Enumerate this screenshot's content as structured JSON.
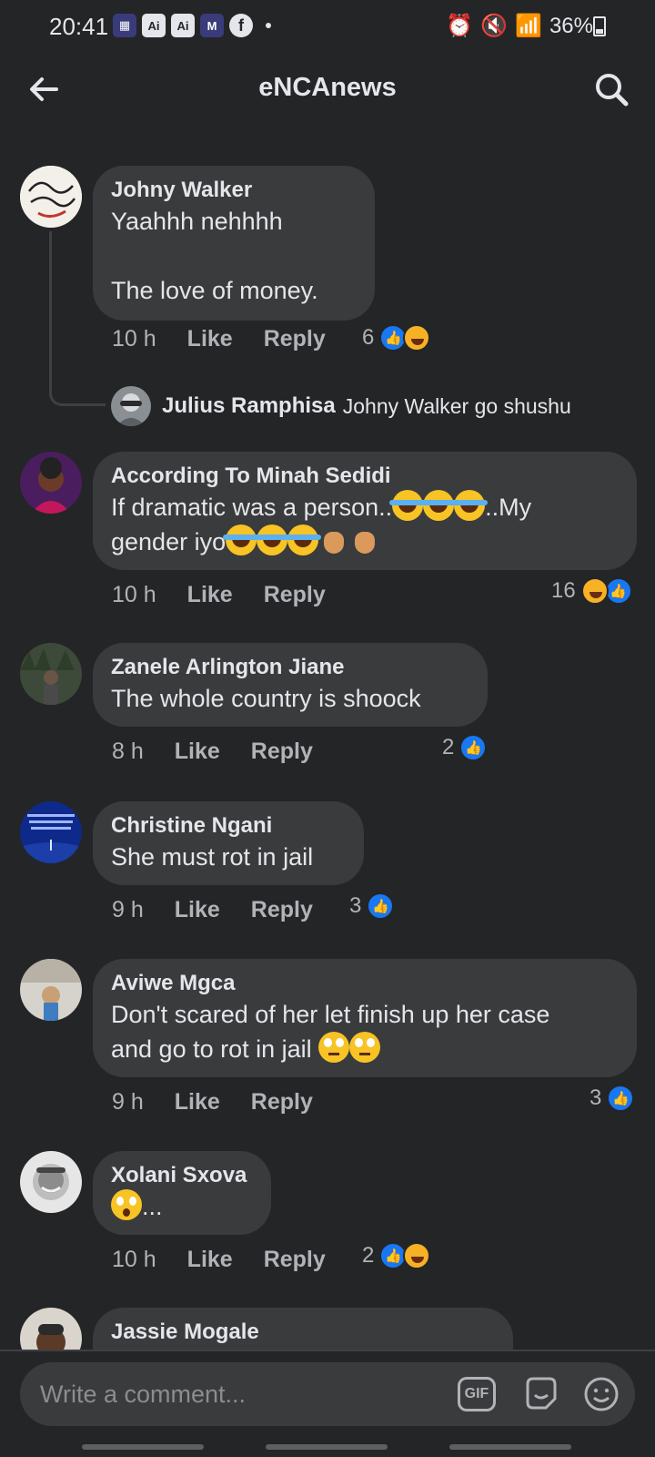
{
  "status": {
    "time": "20:41",
    "apps": [
      "Ai",
      "Ai",
      "M"
    ],
    "battery": "36%"
  },
  "header": {
    "title": "eNCAnews"
  },
  "comments": [
    {
      "name": "Johny Walker",
      "text": "Yaahhh nehhhh\n\nThe love of money.",
      "time": "10 h",
      "like": "Like",
      "reply": "Reply",
      "reactions": "6",
      "reply_preview": {
        "name": "Julius Ramphisa",
        "text": "Johny Walker go shushu"
      }
    },
    {
      "name": "According To Minah Sedidi",
      "text_a": "If dramatic was a person..",
      "text_b": "..My",
      "text_c": "gender iyo",
      "time": "10 h",
      "like": "Like",
      "reply": "Reply",
      "reactions": "16"
    },
    {
      "name": "Zanele Arlington Jiane",
      "text": "The whole country is shoock",
      "time": "8 h",
      "like": "Like",
      "reply": "Reply",
      "reactions": "2"
    },
    {
      "name": "Christine Ngani",
      "text": "She must rot in jail",
      "time": "9 h",
      "like": "Like",
      "reply": "Reply",
      "reactions": "3"
    },
    {
      "name": "Aviwe Mgca",
      "text_a": "Don't scared of her let finish up her case",
      "text_b": "and go to rot in jail ",
      "time": "9 h",
      "like": "Like",
      "reply": "Reply",
      "reactions": "3"
    },
    {
      "name": "Xolani Sxova",
      "text": "...",
      "time": "10 h",
      "like": "Like",
      "reply": "Reply",
      "reactions": "2"
    },
    {
      "name": "Jassie Mogale"
    }
  ],
  "composer": {
    "placeholder": "Write a comment...",
    "gif_label": "GIF"
  },
  "colors": {
    "background": "#242526",
    "bubble": "#3a3b3c",
    "like_blue": "#1877f2",
    "secondary_text": "#b0b3b8"
  }
}
